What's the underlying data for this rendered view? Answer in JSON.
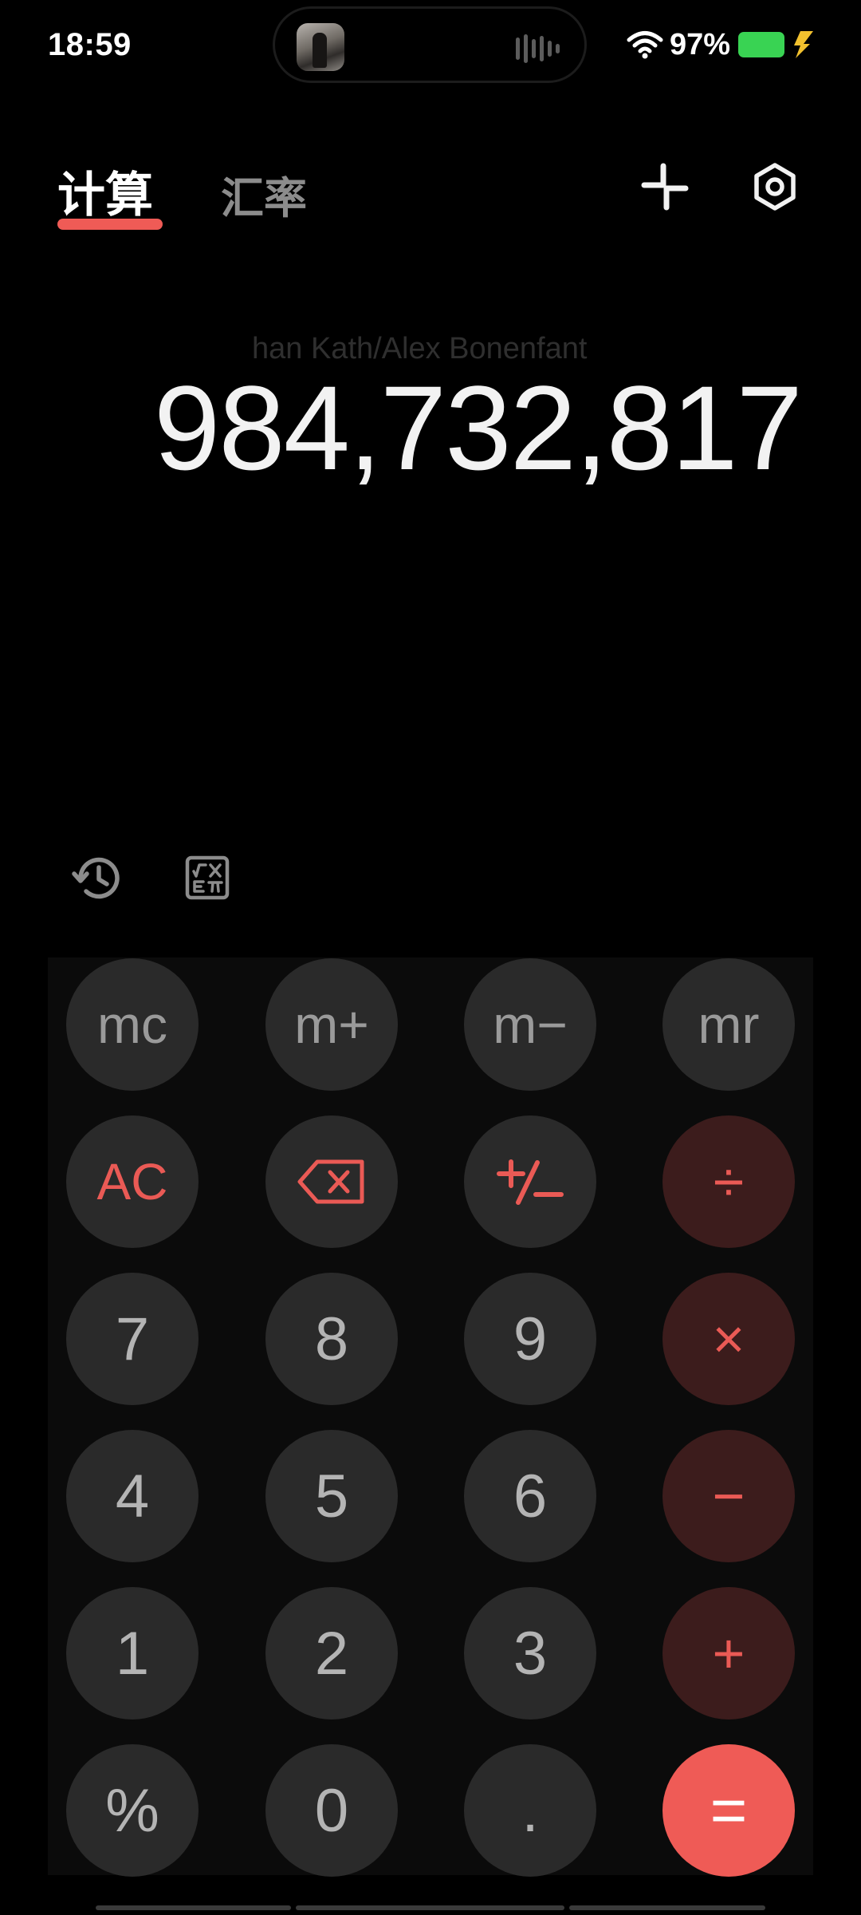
{
  "status_bar": {
    "time": "18:59",
    "battery_percent": "97%",
    "icons": [
      "wifi-icon",
      "battery-icon",
      "charging-icon",
      "audio-wave-icon"
    ],
    "battery_color": "#39d353"
  },
  "tabs": {
    "calculate": "计算",
    "exchange_rate": "汇率",
    "active": "计算",
    "active_indicator_color": "#ef5b56"
  },
  "toolbar": {
    "icons": [
      "collapse-icon",
      "settings-icon"
    ]
  },
  "display": {
    "expression": "han Kath/Alex Bonenfant",
    "result": "984,732,817"
  },
  "tools": {
    "icons": [
      "history-icon",
      "scientific-icon"
    ]
  },
  "keypad": {
    "mc": "mc",
    "m_plus": "m+",
    "m_minus": "m−",
    "mr": "mr",
    "ac": "AC",
    "divide": "÷",
    "multiply": "×",
    "subtract": "−",
    "add": "+",
    "equals": "=",
    "percent": "%",
    "decimal": ".",
    "digits": [
      "0",
      "1",
      "2",
      "3",
      "4",
      "5",
      "6",
      "7",
      "8",
      "9"
    ],
    "operator_bg": "#3c1c1c",
    "accent": "#ea5a55",
    "equals_bg": "#ef5b56"
  }
}
